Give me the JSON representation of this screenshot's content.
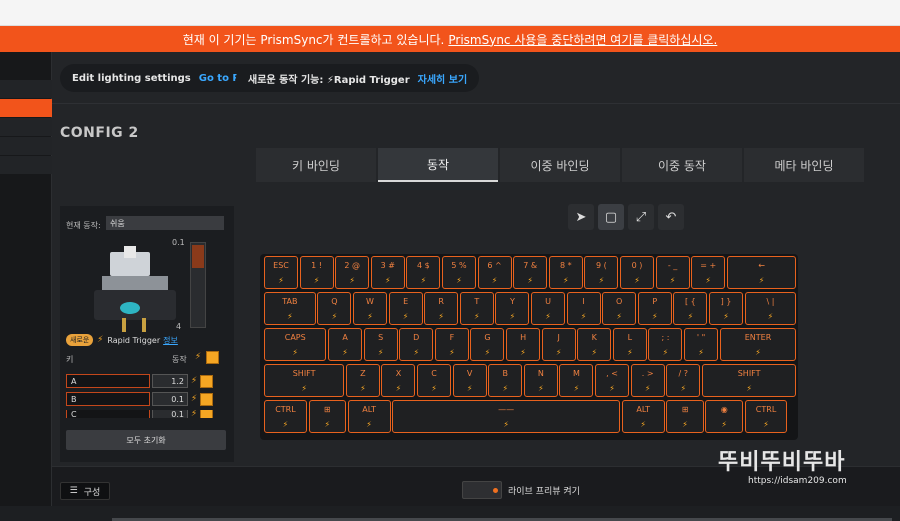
{
  "banner": {
    "text": "현재 이 기기는 PrismSync가 컨트롤하고 있습니다.",
    "link": "PrismSync 사용을 중단하려면 여기를 클릭하십시오."
  },
  "pills": [
    {
      "label": "Edit lighting settings",
      "link": "Go to Prism"
    },
    {
      "label": "새로운 동작 기능: ⚡Rapid Trigger",
      "link": "자세히 보기"
    }
  ],
  "config_title": "CONFIG 2",
  "tabs": [
    "키 바인딩",
    "동작",
    "이중 바인딩",
    "이중 동작",
    "메타 바인딩"
  ],
  "active_tab": "동작",
  "panel": {
    "current_action_label": "현재 동작:",
    "current_action_value": "쉬움",
    "slider_top": "0.1",
    "slider_bottom": "4",
    "slider_fill_fraction": 0.28,
    "new_badge": "새로운",
    "rapid_trigger": "Rapid Trigger",
    "info_link": "정보",
    "col_key": "키",
    "col_action": "동작",
    "rows": [
      {
        "key": "A",
        "value": "1.2"
      },
      {
        "key": "B",
        "value": "0.1"
      },
      {
        "key": "C",
        "value": "0.1"
      }
    ],
    "reset_label": "모두 초기화"
  },
  "tools": [
    "arrow-icon",
    "select-box-icon",
    "expand-icon",
    "undo-icon"
  ],
  "keyboard": {
    "bolt": "⚡",
    "rows": [
      [
        {
          "t": "ESC"
        },
        {
          "t": "1 !"
        },
        {
          "t": "2 @"
        },
        {
          "t": "3 #"
        },
        {
          "t": "4 $"
        },
        {
          "t": "5 %"
        },
        {
          "t": "6 ^"
        },
        {
          "t": "7 &"
        },
        {
          "t": "8 *"
        },
        {
          "t": "9 ("
        },
        {
          "t": "0 )"
        },
        {
          "t": "- _"
        },
        {
          "t": "= +"
        },
        {
          "t": "←"
        }
      ],
      [
        {
          "t": "TAB"
        },
        {
          "t": "Q"
        },
        {
          "t": "W"
        },
        {
          "t": "E"
        },
        {
          "t": "R"
        },
        {
          "t": "T"
        },
        {
          "t": "Y"
        },
        {
          "t": "U"
        },
        {
          "t": "I"
        },
        {
          "t": "O"
        },
        {
          "t": "P"
        },
        {
          "t": "[ {"
        },
        {
          "t": "] }"
        },
        {
          "t": "\\ |"
        }
      ],
      [
        {
          "t": "CAPS"
        },
        {
          "t": "A"
        },
        {
          "t": "S"
        },
        {
          "t": "D"
        },
        {
          "t": "F"
        },
        {
          "t": "G"
        },
        {
          "t": "H"
        },
        {
          "t": "J"
        },
        {
          "t": "K"
        },
        {
          "t": "L"
        },
        {
          "t": "; :"
        },
        {
          "t": "' \""
        },
        {
          "t": "ENTER"
        }
      ],
      [
        {
          "t": "SHIFT"
        },
        {
          "t": "Z"
        },
        {
          "t": "X"
        },
        {
          "t": "C"
        },
        {
          "t": "V"
        },
        {
          "t": "B"
        },
        {
          "t": "N"
        },
        {
          "t": "M"
        },
        {
          "t": ", <"
        },
        {
          "t": ". >"
        },
        {
          "t": "/ ?"
        },
        {
          "t": "SHIFT"
        }
      ],
      [
        {
          "t": "CTRL"
        },
        {
          "t": "⊞"
        },
        {
          "t": "ALT"
        },
        {
          "t": "——"
        },
        {
          "t": "ALT"
        },
        {
          "t": "⊞"
        },
        {
          "t": "◉"
        },
        {
          "t": "CTRL"
        }
      ]
    ]
  },
  "bottom": {
    "config_button": "구성",
    "live_preview": "라이브 프리뷰 켜기"
  },
  "watermark": {
    "line1": "뚜비뚜비뚜바",
    "line2": "https://idsam209.com"
  },
  "colors": {
    "accent": "#f2541b",
    "key_border": "#e8621e",
    "bolt": "#f5a623"
  }
}
